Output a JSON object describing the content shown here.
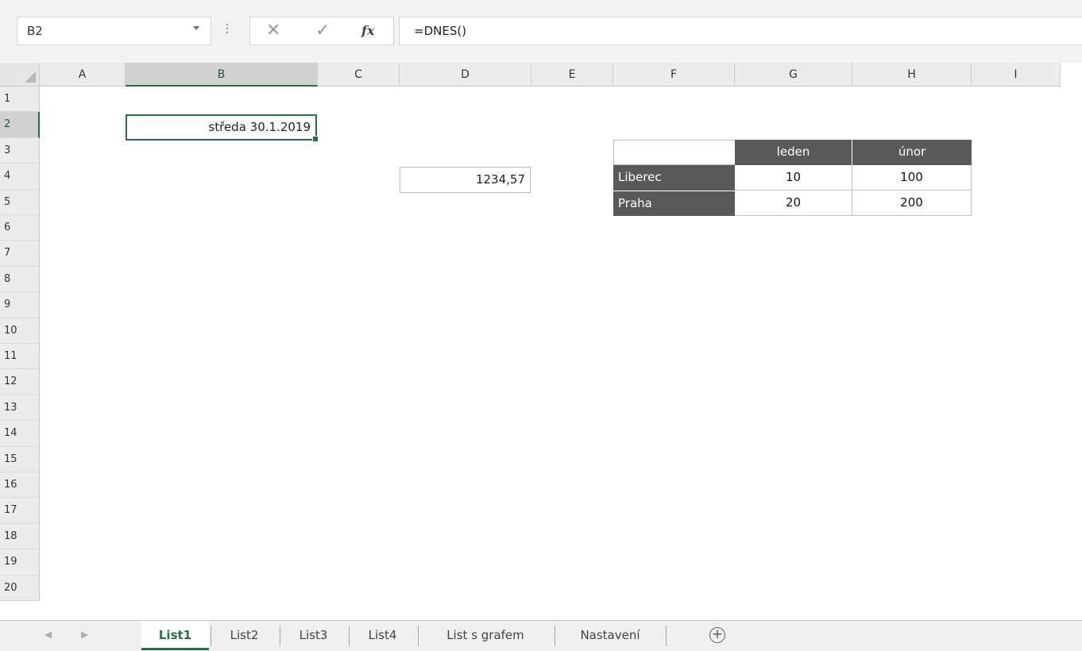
{
  "formula_bar": {
    "name_box": "B2",
    "formula": "=DNES()",
    "cancel_icon": "close-icon",
    "enter_icon": "check-icon",
    "function_icon": "fx-icon"
  },
  "columns": [
    "A",
    "B",
    "C",
    "D",
    "E",
    "F",
    "G",
    "H",
    "I"
  ],
  "rows": [
    "1",
    "2",
    "3",
    "4",
    "5",
    "6",
    "7",
    "8",
    "9",
    "10",
    "11",
    "12",
    "13",
    "14",
    "15",
    "16",
    "17",
    "18",
    "19",
    "20"
  ],
  "selected_cell": "B2",
  "cells": {
    "B2": "středa 30.1.2019",
    "D4": "1234,57"
  },
  "table": {
    "headers": [
      "",
      "leden",
      "únor"
    ],
    "rows": [
      {
        "label": "Liberec",
        "values": [
          "10",
          "100"
        ]
      },
      {
        "label": "Praha",
        "values": [
          "20",
          "200"
        ]
      }
    ]
  },
  "sheet_tabs": [
    "List1",
    "List2",
    "List3",
    "List4",
    "List s grafem",
    "Nastavení"
  ],
  "active_tab": "List1",
  "colors": {
    "accent": "#217346",
    "table_header": "#595959"
  }
}
